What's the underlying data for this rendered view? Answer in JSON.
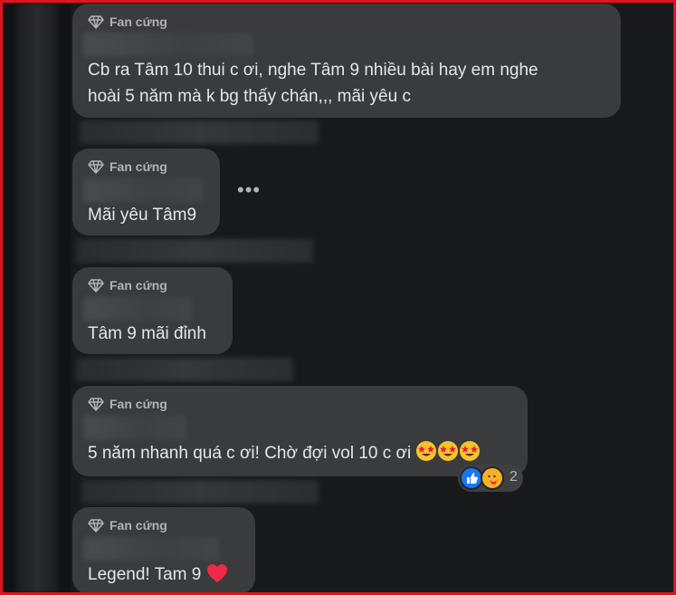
{
  "badge_label": "Fan cứng",
  "comments": [
    {
      "line1": "Cb ra Tâm 10 thui c ơi, nghe Tâm 9 nhiều bài hay em nghe",
      "line2": "hoài 5 năm mà k bg thấy chán,,, mãi yêu c"
    },
    {
      "text": "Mãi yêu Tâm9"
    },
    {
      "text": "Tâm 9 mãi đỉnh"
    },
    {
      "text": "5 năm nhanh quá c ơi! Chờ đợi vol 10 c ơi"
    },
    {
      "text": "Legend! Tam 9"
    }
  ],
  "more_label": "•••",
  "reactions": {
    "count": "2",
    "types": [
      "like-icon",
      "care-icon"
    ]
  },
  "icons": {
    "badge": "diamond-icon",
    "heart": "heart-icon",
    "star_eyes": "star-struck-emoji"
  },
  "colors": {
    "bubble": "#3a3b3c",
    "background": "#18191a",
    "like": "#1877f2",
    "heart": "#f02849"
  }
}
